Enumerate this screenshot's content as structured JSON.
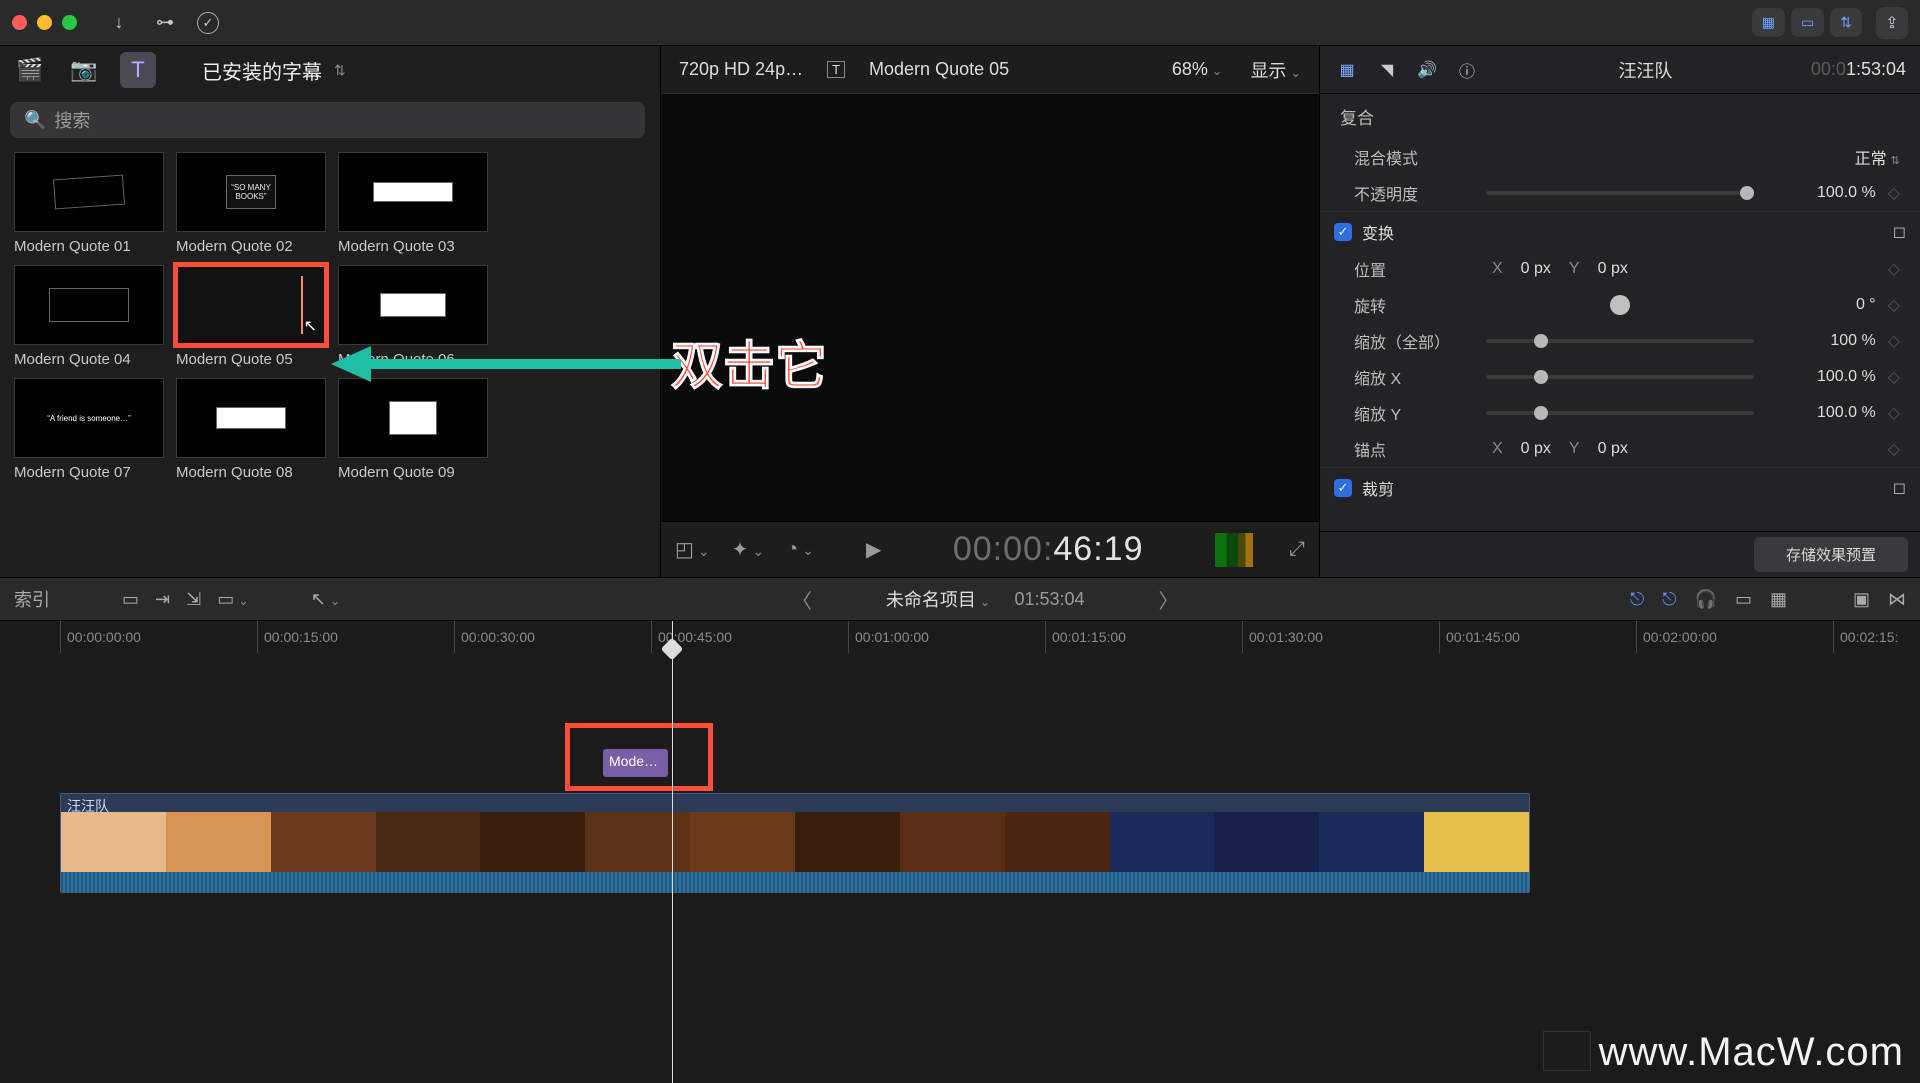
{
  "titlebar": {
    "view_pills": [
      "⊞⊞",
      "▭▭",
      "⚙"
    ]
  },
  "browser": {
    "category_label": "已安装的字幕",
    "search_placeholder": "搜索",
    "items": [
      {
        "label": "Modern Quote 01"
      },
      {
        "label": "Modern Quote 02"
      },
      {
        "label": "Modern Quote 03"
      },
      {
        "label": "Modern Quote 04"
      },
      {
        "label": "Modern Quote 05",
        "selected": true
      },
      {
        "label": "Modern Quote 06"
      },
      {
        "label": "Modern Quote 07"
      },
      {
        "label": "Modern Quote 08"
      },
      {
        "label": "Modern Quote 09"
      }
    ]
  },
  "viewer": {
    "format": "720p HD 24p…",
    "clip_name": "Modern Quote 05",
    "zoom": "68%",
    "display_label": "显示",
    "timecode_dim": "00:00:",
    "timecode_bright": "46:19"
  },
  "inspector": {
    "project_name": "汪汪队",
    "duration_dim": "00:0",
    "duration_bright": "1:53:04",
    "composite_header": "复合",
    "blend_label": "混合模式",
    "blend_value": "正常",
    "opacity_label": "不透明度",
    "opacity_value": "100.0 %",
    "transform_header": "变换",
    "position_label": "位置",
    "pos_x_axis": "X",
    "pos_x_val": "0 px",
    "pos_y_axis": "Y",
    "pos_y_val": "0 px",
    "rotation_label": "旋转",
    "rotation_value": "0 °",
    "scale_all_label": "缩放（全部）",
    "scale_all_value": "100 %",
    "scale_x_label": "缩放 X",
    "scale_x_value": "100.0 %",
    "scale_y_label": "缩放 Y",
    "scale_y_value": "100.0 %",
    "anchor_label": "锚点",
    "anchor_x_axis": "X",
    "anchor_x_val": "0 px",
    "anchor_y_axis": "Y",
    "anchor_y_val": "0 px",
    "crop_header": "裁剪",
    "save_preset": "存储效果预置"
  },
  "timeline_header": {
    "index_label": "索引",
    "project_label": "未命名项目",
    "duration": "01:53:04"
  },
  "timeline": {
    "ruler": [
      "00:00:00:00",
      "00:00:15:00",
      "00:00:30:00",
      "00:00:45:00",
      "00:01:00:00",
      "00:01:15:00",
      "00:01:30:00",
      "00:01:45:00",
      "00:02:00:00",
      "00:02:15:"
    ],
    "title_clip_label": "Mode…",
    "video_clip_name": "汪汪队"
  },
  "annotation": {
    "text": "双击它"
  },
  "watermark": "www.MacW.com"
}
